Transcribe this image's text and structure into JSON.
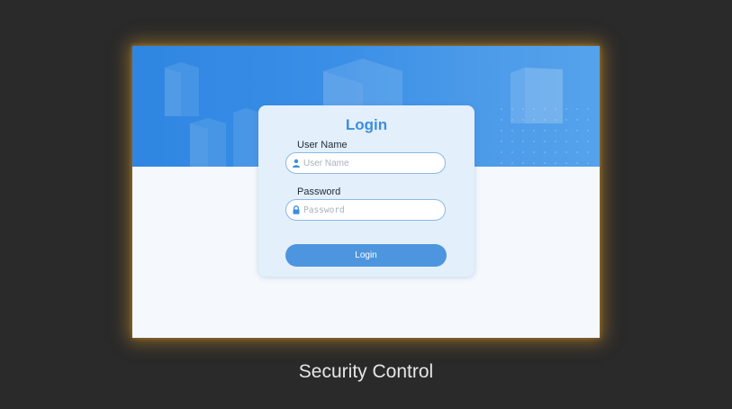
{
  "login_form": {
    "title": "Login",
    "username": {
      "label": "User Name",
      "placeholder": "User Name",
      "value": "",
      "icon": "user-icon"
    },
    "password": {
      "label": "Password",
      "placeholder": "Password",
      "value": "",
      "icon": "lock-icon"
    },
    "submit_label": "Login"
  },
  "caption": "Security Control",
  "colors": {
    "background": "#2a2a2a",
    "banner_blue": "#2f86e2",
    "card_background": "#e3effb",
    "title_blue": "#3b8fdc",
    "button_blue": "#4d95df",
    "frame_glow": "#d69628"
  }
}
